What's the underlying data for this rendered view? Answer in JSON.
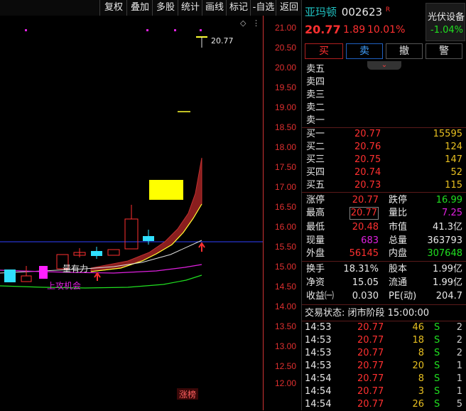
{
  "toolbar": {
    "items": [
      "复权",
      "叠加",
      "多股",
      "统计",
      "画线",
      "标记",
      "-自选",
      "返回"
    ]
  },
  "stock": {
    "name": "亚玛顿",
    "code": "002623",
    "flag": "R",
    "price": "20.77",
    "change": "1.89",
    "pct": "10.01%",
    "sector": "光伏设备",
    "sector_pct": "-1.04%"
  },
  "actions": {
    "buy": "买",
    "sell": "卖",
    "cancel": "撤",
    "alert": "警"
  },
  "asks": [
    {
      "label": "卖五"
    },
    {
      "label": "卖四"
    },
    {
      "label": "卖三"
    },
    {
      "label": "卖二"
    },
    {
      "label": "卖一"
    }
  ],
  "bids": [
    {
      "label": "买一",
      "price": "20.77",
      "vol": "15595"
    },
    {
      "label": "买二",
      "price": "20.76",
      "vol": "124"
    },
    {
      "label": "买三",
      "price": "20.75",
      "vol": "147"
    },
    {
      "label": "买四",
      "price": "20.74",
      "vol": "52"
    },
    {
      "label": "买五",
      "price": "20.73",
      "vol": "115"
    }
  ],
  "stats": [
    [
      {
        "k": "涨停",
        "v": "20.77"
      },
      {
        "k": "跌停",
        "v": "16.99"
      }
    ],
    [
      {
        "k": "最高",
        "v": "20.77"
      },
      {
        "k": "量比",
        "v": "7.25"
      }
    ],
    [
      {
        "k": "最低",
        "v": "20.48"
      },
      {
        "k": "市值",
        "v": "41.3亿"
      }
    ],
    [
      {
        "k": "现量",
        "v": "683"
      },
      {
        "k": "总量",
        "v": "363793"
      }
    ],
    [
      {
        "k": "外盘",
        "v": "56145"
      },
      {
        "k": "内盘",
        "v": "307648"
      }
    ]
  ],
  "fund": [
    [
      {
        "k": "换手",
        "v": "18.31%"
      },
      {
        "k": "股本",
        "v": "1.99亿"
      }
    ],
    [
      {
        "k": "净资",
        "v": "15.05"
      },
      {
        "k": "流通",
        "v": "1.99亿"
      }
    ],
    [
      {
        "k": "收益㈠",
        "v": "0.030"
      },
      {
        "k": "PE(动)",
        "v": "204.7"
      }
    ]
  ],
  "status": "交易状态: 闭市阶段 15:00:00",
  "ticks": [
    {
      "t": "14:53",
      "p": "20.77",
      "v": "46",
      "s": "S",
      "n": "2"
    },
    {
      "t": "14:53",
      "p": "20.77",
      "v": "18",
      "s": "S",
      "n": "2"
    },
    {
      "t": "14:53",
      "p": "20.77",
      "v": "8",
      "s": "S",
      "n": "2"
    },
    {
      "t": "14:53",
      "p": "20.77",
      "v": "20",
      "s": "S",
      "n": "1"
    },
    {
      "t": "14:54",
      "p": "20.77",
      "v": "8",
      "s": "S",
      "n": "1"
    },
    {
      "t": "14:54",
      "p": "20.77",
      "v": "3",
      "s": "S",
      "n": "1"
    },
    {
      "t": "14:54",
      "p": "20.77",
      "v": "26",
      "s": "S",
      "n": "5"
    }
  ],
  "chart": {
    "yticks": [
      "21.00",
      "20.50",
      "20.00",
      "19.50",
      "19.00",
      "18.50",
      "18.00",
      "17.50",
      "17.00",
      "16.50",
      "16.00",
      "15.50",
      "15.00",
      "14.50",
      "14.00",
      "13.50",
      "13.00",
      "12.50",
      "12.00"
    ],
    "price_label": "20.77",
    "annot1": "量有力",
    "annot2": "上攻机会",
    "footer": "涨榜",
    "colors": {
      "up": "#ff3030",
      "down": "#20e0e0",
      "band": "#a02020"
    }
  }
}
